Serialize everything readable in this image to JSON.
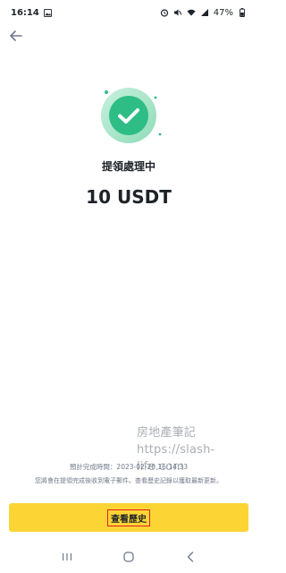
{
  "status_bar": {
    "time": "16:14",
    "battery": "47%"
  },
  "withdraw": {
    "status_title": "提領處理中",
    "amount": "10 USDT",
    "estimated_completion": "預計完成時間：2023-02-20 16:14:33",
    "email_note": "您將會在提領完成後收到電子郵件。查看歷史記錄以獲取最新更新。"
  },
  "watermark": {
    "line1": "房地產筆記",
    "line2": "https://slash-life.com"
  },
  "actions": {
    "view_history_label": "查看歷史"
  },
  "colors": {
    "accent_yellow": "#fcd535",
    "success_green": "#2ebd85",
    "highlight_red": "#e02020",
    "text_primary": "#1e2329",
    "text_secondary": "#707a8a"
  },
  "icons": {
    "back": "arrow-left-icon",
    "success": "checkmark-circle-icon",
    "nav_recents": "recents-icon",
    "nav_home": "home-icon",
    "nav_back": "chevron-left-icon"
  }
}
